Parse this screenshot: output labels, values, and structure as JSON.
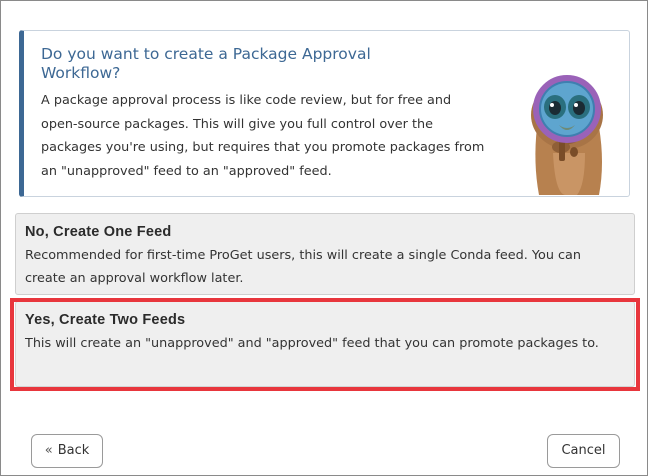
{
  "info": {
    "title": "Do you want to create a Package Approval Workflow?",
    "body": "A package approval process is like code review, but for free and open-source packages. This will give you full control over the packages you're using, but requires that you promote packages from an \"unapproved\" feed to an \"approved\" feed.",
    "mascot_icon": "groundhog-magnifier-icon"
  },
  "options": [
    {
      "title": "No, Create One Feed",
      "description": "Recommended for first-time ProGet users, this will create a single Conda feed. You can create an approval workflow later."
    },
    {
      "title": "Yes, Create Two Feeds",
      "description": "This will create an \"unapproved\" and \"approved\" feed that you can promote packages to.",
      "highlighted": true
    }
  ],
  "footer": {
    "back_chevron": "«",
    "back_label": "Back",
    "cancel_label": "Cancel"
  },
  "colors": {
    "accent": "#3d6894",
    "highlight": "#e8363d",
    "option_bg": "#efefef"
  }
}
